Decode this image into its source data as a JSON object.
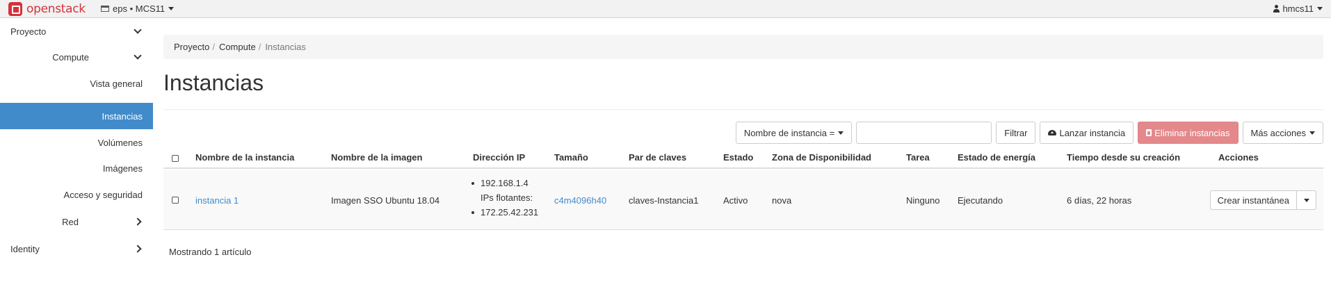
{
  "topbar": {
    "logo_text": "openstack",
    "project_label": "eps • MCS11",
    "user_label": "hmcs11"
  },
  "sidebar": {
    "items": [
      {
        "label": "Proyecto",
        "level": 0,
        "chevron": "down"
      },
      {
        "label": "Compute",
        "level": 1,
        "chevron": "down"
      },
      {
        "label": "Vista general",
        "level": 2
      },
      {
        "label": "Instancias",
        "level": 2,
        "active": true
      },
      {
        "label": "Volúmenes",
        "level": 2
      },
      {
        "label": "Imágenes",
        "level": 2
      },
      {
        "label": "Acceso y seguridad",
        "level": 2
      },
      {
        "label": "Red",
        "level": 1,
        "chevron": "right"
      },
      {
        "label": "Identity",
        "level": 0,
        "chevron": "right"
      }
    ]
  },
  "breadcrumb": [
    "Proyecto",
    "Compute",
    "Instancias"
  ],
  "page_title": "Instancias",
  "toolbar": {
    "filter_select": "Nombre de instancia =",
    "filter_input_value": "",
    "filter_button": "Filtrar",
    "launch_button": "Lanzar instancia",
    "delete_button": "Eliminar instancias",
    "more_button": "Más acciones"
  },
  "table": {
    "headers": [
      "Nombre de la instancia",
      "Nombre de la imagen",
      "Dirección IP",
      "Tamaño",
      "Par de claves",
      "Estado",
      "Zona de Disponibilidad",
      "Tarea",
      "Estado de energía",
      "Tiempo desde su creación",
      "Acciones"
    ],
    "rows": [
      {
        "name": "instancia 1",
        "image": "Imagen SSO Ubuntu 18.04",
        "ip_fixed": "192.168.1.4",
        "ip_floating_label": "IPs flotantes:",
        "ip_floating": "172.25.42.231",
        "size": "c4m4096h40",
        "keypair": "claves-Instancia1",
        "status": "Activo",
        "zone": "nova",
        "task": "Ninguno",
        "power": "Ejecutando",
        "age": "6 días, 22 horas",
        "action": "Crear instantánea"
      }
    ],
    "footer": "Mostrando 1 artículo"
  },
  "colors": {
    "active_nav": "#428bca",
    "link": "#428bca",
    "danger_button": "#e4898b",
    "brand": "#d6323b"
  }
}
